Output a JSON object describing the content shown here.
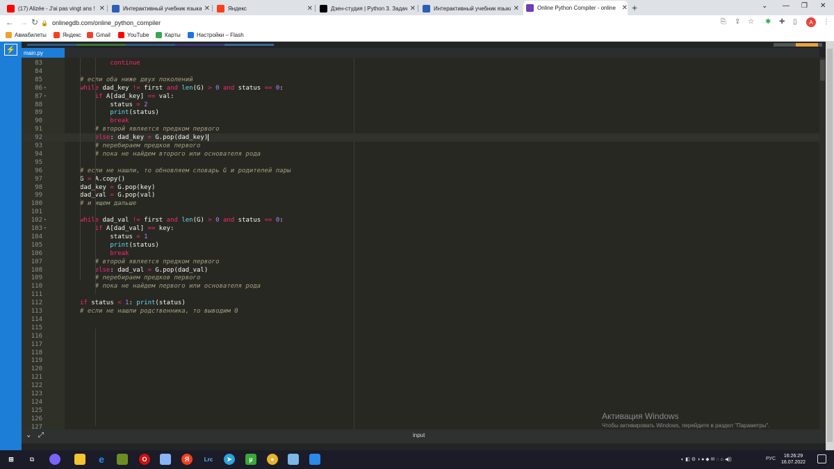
{
  "browser": {
    "tabs": [
      {
        "title": "(17) Alizée - J'ai pas vingt ans ! (",
        "icon": "youtube-icon",
        "color": "#ff0000"
      },
      {
        "title": "Интерактивный учебник языка",
        "icon": "practicum-icon",
        "color": "#2b5fb4"
      },
      {
        "title": "Яндекс",
        "icon": "yandex-icon",
        "color": "#fc3f1d"
      },
      {
        "title": "Дзен-студия | Python 3. Задача –",
        "icon": "zen-icon",
        "color": "#000000"
      },
      {
        "title": "Интерактивный учебник языка",
        "icon": "practicum-icon",
        "color": "#2b5fb4"
      },
      {
        "title": "Online Python Compiler - online",
        "icon": "onlinegdb-icon",
        "color": "#6f3fb3"
      }
    ],
    "new_tab": "+",
    "url": "onlinegdb.com/online_python_compiler",
    "avatar_letter": "A",
    "bookmarks": [
      {
        "label": "Авиабилеты",
        "icon": "plane-icon",
        "color": "#f0a030"
      },
      {
        "label": "Яндекс",
        "icon": "yandex-icon",
        "color": "#fc3f1d"
      },
      {
        "label": "Gmail",
        "icon": "gmail-icon",
        "color": "#ea4335"
      },
      {
        "label": "YouTube",
        "icon": "youtube-icon",
        "color": "#ff0000"
      },
      {
        "label": "Карты",
        "icon": "maps-icon",
        "color": "#34a853"
      },
      {
        "label": "Настройки – Flash",
        "icon": "gear-icon",
        "color": "#1a73e8"
      }
    ]
  },
  "editor": {
    "file_tab": "main.py",
    "bottom_label": "input",
    "lines": [
      {
        "n": "83",
        "fold": "",
        "ind": 4,
        "tokens": [
          [
            "k",
            "continue"
          ]
        ]
      },
      {
        "n": "84",
        "fold": "",
        "ind": 0,
        "tokens": []
      },
      {
        "n": "85",
        "fold": "",
        "ind": 0,
        "tokens": [
          [
            "c",
            "# если оба ниже двух поколений"
          ]
        ]
      },
      {
        "n": "86",
        "fold": "▾",
        "ind": 0,
        "tokens": [
          [
            "k",
            "while"
          ],
          [
            "t",
            " dad_key "
          ],
          [
            "o",
            "!="
          ],
          [
            "t",
            " first "
          ],
          [
            "k",
            "and"
          ],
          [
            "t",
            " "
          ],
          [
            "f",
            "len"
          ],
          [
            "t",
            "(G) "
          ],
          [
            "o",
            ">"
          ],
          [
            "t",
            " "
          ],
          [
            "n",
            "0"
          ],
          [
            "t",
            " "
          ],
          [
            "k",
            "and"
          ],
          [
            "t",
            " status "
          ],
          [
            "o",
            "=="
          ],
          [
            "t",
            " "
          ],
          [
            "n",
            "0"
          ],
          [
            "t",
            ":"
          ]
        ]
      },
      {
        "n": "87",
        "fold": "▾",
        "ind": 2,
        "tokens": [
          [
            "k",
            "if"
          ],
          [
            "t",
            " A[dad_key] "
          ],
          [
            "o",
            "=="
          ],
          [
            "t",
            " val:"
          ]
        ]
      },
      {
        "n": "88",
        "fold": "",
        "ind": 4,
        "tokens": [
          [
            "t",
            "status "
          ],
          [
            "o",
            "="
          ],
          [
            "t",
            " "
          ],
          [
            "n",
            "2"
          ]
        ]
      },
      {
        "n": "89",
        "fold": "",
        "ind": 4,
        "tokens": [
          [
            "f",
            "print"
          ],
          [
            "t",
            "(status)"
          ]
        ]
      },
      {
        "n": "90",
        "fold": "",
        "ind": 4,
        "tokens": [
          [
            "k",
            "break"
          ]
        ]
      },
      {
        "n": "91",
        "fold": "",
        "ind": 2,
        "tokens": [
          [
            "c",
            "# второй является предком первого"
          ]
        ]
      },
      {
        "n": "92",
        "fold": "",
        "ind": 2,
        "cur": true,
        "tokens": [
          [
            "k",
            "else"
          ],
          [
            "t",
            ": dad_key "
          ],
          [
            "o",
            "="
          ],
          [
            "t",
            " G.pop(dad_key)"
          ],
          [
            "cursor",
            ""
          ]
        ]
      },
      {
        "n": "93",
        "fold": "",
        "ind": 2,
        "tokens": [
          [
            "c",
            "# перебираем предков первого"
          ]
        ]
      },
      {
        "n": "94",
        "fold": "",
        "ind": 2,
        "tokens": [
          [
            "c",
            "# пока не найдем второго или основателя рода"
          ]
        ]
      },
      {
        "n": "95",
        "fold": "",
        "ind": 0,
        "tokens": []
      },
      {
        "n": "96",
        "fold": "",
        "ind": 0,
        "tokens": [
          [
            "c",
            "# если не нашли, то обновляем словарь G и родителей пары"
          ]
        ]
      },
      {
        "n": "97",
        "fold": "",
        "ind": 0,
        "tokens": [
          [
            "t",
            "G "
          ],
          [
            "o",
            "="
          ],
          [
            "t",
            " A.copy()"
          ]
        ]
      },
      {
        "n": "98",
        "fold": "",
        "ind": 0,
        "tokens": [
          [
            "t",
            "dad_key "
          ],
          [
            "o",
            "="
          ],
          [
            "t",
            " G.pop(key)"
          ]
        ]
      },
      {
        "n": "99",
        "fold": "",
        "ind": 0,
        "tokens": [
          [
            "t",
            "dad_val "
          ],
          [
            "o",
            "="
          ],
          [
            "t",
            " G.pop(val)"
          ]
        ]
      },
      {
        "n": "100",
        "fold": "",
        "ind": 0,
        "tokens": [
          [
            "c",
            "# и ищем дальше"
          ]
        ]
      },
      {
        "n": "101",
        "fold": "",
        "ind": 0,
        "tokens": []
      },
      {
        "n": "102",
        "fold": "▾",
        "ind": 0,
        "tokens": [
          [
            "k",
            "while"
          ],
          [
            "t",
            " dad_val "
          ],
          [
            "o",
            "!="
          ],
          [
            "t",
            " first "
          ],
          [
            "k",
            "and"
          ],
          [
            "t",
            " "
          ],
          [
            "f",
            "len"
          ],
          [
            "t",
            "(G) "
          ],
          [
            "o",
            ">"
          ],
          [
            "t",
            " "
          ],
          [
            "n",
            "0"
          ],
          [
            "t",
            " "
          ],
          [
            "k",
            "and"
          ],
          [
            "t",
            " status "
          ],
          [
            "o",
            "=="
          ],
          [
            "t",
            " "
          ],
          [
            "n",
            "0"
          ],
          [
            "t",
            ":"
          ]
        ]
      },
      {
        "n": "103",
        "fold": "▾",
        "ind": 2,
        "tokens": [
          [
            "k",
            "if"
          ],
          [
            "t",
            " A[dad_val] "
          ],
          [
            "o",
            "=="
          ],
          [
            "t",
            " key:"
          ]
        ]
      },
      {
        "n": "104",
        "fold": "",
        "ind": 4,
        "tokens": [
          [
            "t",
            "status "
          ],
          [
            "o",
            "="
          ],
          [
            "t",
            " "
          ],
          [
            "n",
            "1"
          ]
        ]
      },
      {
        "n": "105",
        "fold": "",
        "ind": 4,
        "tokens": [
          [
            "f",
            "print"
          ],
          [
            "t",
            "(status)"
          ]
        ]
      },
      {
        "n": "106",
        "fold": "",
        "ind": 4,
        "tokens": [
          [
            "k",
            "break"
          ]
        ]
      },
      {
        "n": "107",
        "fold": "",
        "ind": 2,
        "tokens": [
          [
            "c",
            "# второй является предком первого"
          ]
        ]
      },
      {
        "n": "108",
        "fold": "",
        "ind": 2,
        "tokens": [
          [
            "k",
            "else"
          ],
          [
            "t",
            ": dad_val "
          ],
          [
            "o",
            "="
          ],
          [
            "t",
            " G.pop(dad_val)"
          ]
        ]
      },
      {
        "n": "109",
        "fold": "",
        "ind": 2,
        "tokens": [
          [
            "c",
            "# перебираем предков первого"
          ]
        ]
      },
      {
        "n": "110",
        "fold": "",
        "ind": 2,
        "tokens": [
          [
            "c",
            "# пока не найдем первого или основателя рода"
          ]
        ]
      },
      {
        "n": "111",
        "fold": "",
        "ind": 0,
        "tokens": []
      },
      {
        "n": "112",
        "fold": "",
        "ind": 0,
        "tokens": [
          [
            "k",
            "if"
          ],
          [
            "t",
            " status "
          ],
          [
            "o",
            "<"
          ],
          [
            "t",
            " "
          ],
          [
            "n",
            "1"
          ],
          [
            "t",
            ": "
          ],
          [
            "f",
            "print"
          ],
          [
            "t",
            "(status)"
          ]
        ]
      },
      {
        "n": "113",
        "fold": "",
        "ind": 0,
        "tokens": [
          [
            "c",
            "# если не нашли родственника, то выводим 0"
          ]
        ]
      },
      {
        "n": "114",
        "fold": "",
        "ind": 0,
        "tokens": []
      },
      {
        "n": "115",
        "fold": "",
        "ind": 0,
        "tokens": []
      },
      {
        "n": "116",
        "fold": "",
        "ind": 0,
        "tokens": []
      },
      {
        "n": "117",
        "fold": "",
        "ind": 0,
        "tokens": []
      },
      {
        "n": "118",
        "fold": "",
        "ind": 0,
        "tokens": []
      },
      {
        "n": "119",
        "fold": "",
        "ind": 0,
        "tokens": []
      },
      {
        "n": "120",
        "fold": "",
        "ind": 0,
        "tokens": []
      },
      {
        "n": "121",
        "fold": "",
        "ind": 0,
        "tokens": []
      },
      {
        "n": "122",
        "fold": "",
        "ind": 0,
        "tokens": []
      },
      {
        "n": "123",
        "fold": "",
        "ind": 0,
        "tokens": []
      },
      {
        "n": "124",
        "fold": "",
        "ind": 0,
        "tokens": []
      },
      {
        "n": "125",
        "fold": "",
        "ind": 0,
        "tokens": []
      },
      {
        "n": "126",
        "fold": "",
        "ind": 0,
        "tokens": []
      },
      {
        "n": "127",
        "fold": "",
        "ind": 0,
        "tokens": []
      }
    ]
  },
  "watermark": {
    "title": "Активация Windows",
    "subtitle": "Чтобы активировать Windows, перейдите в раздел \"Параметры\"."
  },
  "taskbar": {
    "lang": "РУС",
    "time": "16:26:29",
    "date": "16.07.2022"
  }
}
